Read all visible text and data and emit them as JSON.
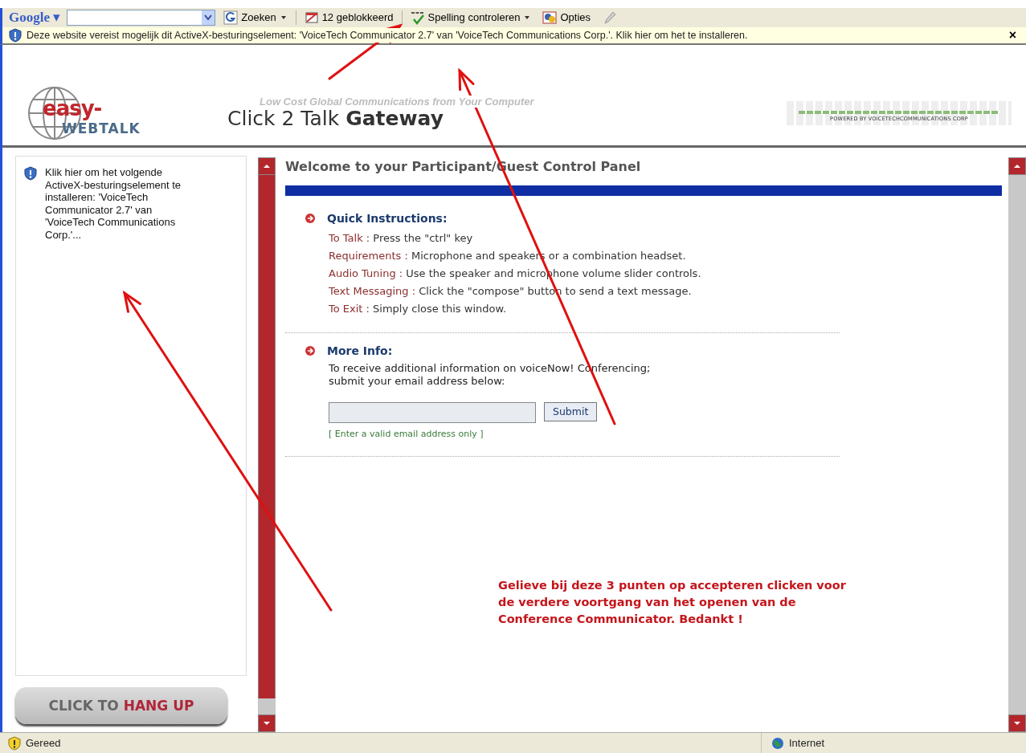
{
  "toolbar": {
    "brand": "Google",
    "brand_caret": "▾",
    "buttons": [
      {
        "kind": "search",
        "label": "Zoeken",
        "dropdown": true
      },
      {
        "kind": "popup",
        "label": "12 geblokkeerd",
        "dropdown": false
      },
      {
        "kind": "spell",
        "label": "Spelling controleren",
        "dropdown": true
      },
      {
        "kind": "options",
        "label": "Opties",
        "dropdown": false
      },
      {
        "kind": "marker"
      }
    ]
  },
  "info_bar": {
    "text": "Deze website vereist mogelijk dit ActiveX-besturingselement: 'VoiceTech Communicator 2.7' van 'VoiceTech Communications Corp.'. Klik hier om het te installeren.",
    "close": "×"
  },
  "header": {
    "logo_top": "easy-",
    "logo_bottom": "WEBTALK",
    "tagline": "Low Cost Global Communications from Your Computer",
    "title": "Click 2 Talk **Gateway**",
    "powered_by": "POWERED BY VOICETECHCOMMUNICATIONS CORP"
  },
  "side_panel": {
    "message": "Klik hier om het volgende ActiveX-besturingselement te installeren: 'VoiceTech Communicator 2.7' van 'VoiceTech Communications Corp.'...",
    "hangup_prefix": "CLICK TO",
    "hangup_action": "HANG UP"
  },
  "main": {
    "welcome": "Welcome to your **Participant/Guest Control Panel**",
    "sections": [
      {
        "heading": "Quick Instructions:",
        "lines": [
          {
            "label": "To Talk :",
            "text": "Press the \"ctrl\" key"
          },
          {
            "label": "Requirements :",
            "text": "Microphone and speakers or a combination headset."
          },
          {
            "label": "Audio Tuning :",
            "text": "Use the speaker and microphone volume slider controls."
          },
          {
            "label": "Text Messaging :",
            "text": "Click the \"compose\" button to send a text message."
          },
          {
            "label": "To Exit :",
            "text": "Simply close this window."
          }
        ]
      },
      {
        "heading": "More Info:",
        "lines": [
          {
            "text": "To receive additional information on voiceNow! Conferencing;"
          },
          {
            "text": "submit your email address below:"
          }
        ]
      }
    ],
    "email": {
      "button": "Submit",
      "hint": "[ Enter a valid email address only ]"
    },
    "note": "Gelieve bij deze 3 punten op accepteren clicken voor de verdere voortgang van het openen van de Conference Communicator. Bedankt !"
  },
  "status_bar": {
    "status": "Gereed",
    "zone": "Internet"
  }
}
